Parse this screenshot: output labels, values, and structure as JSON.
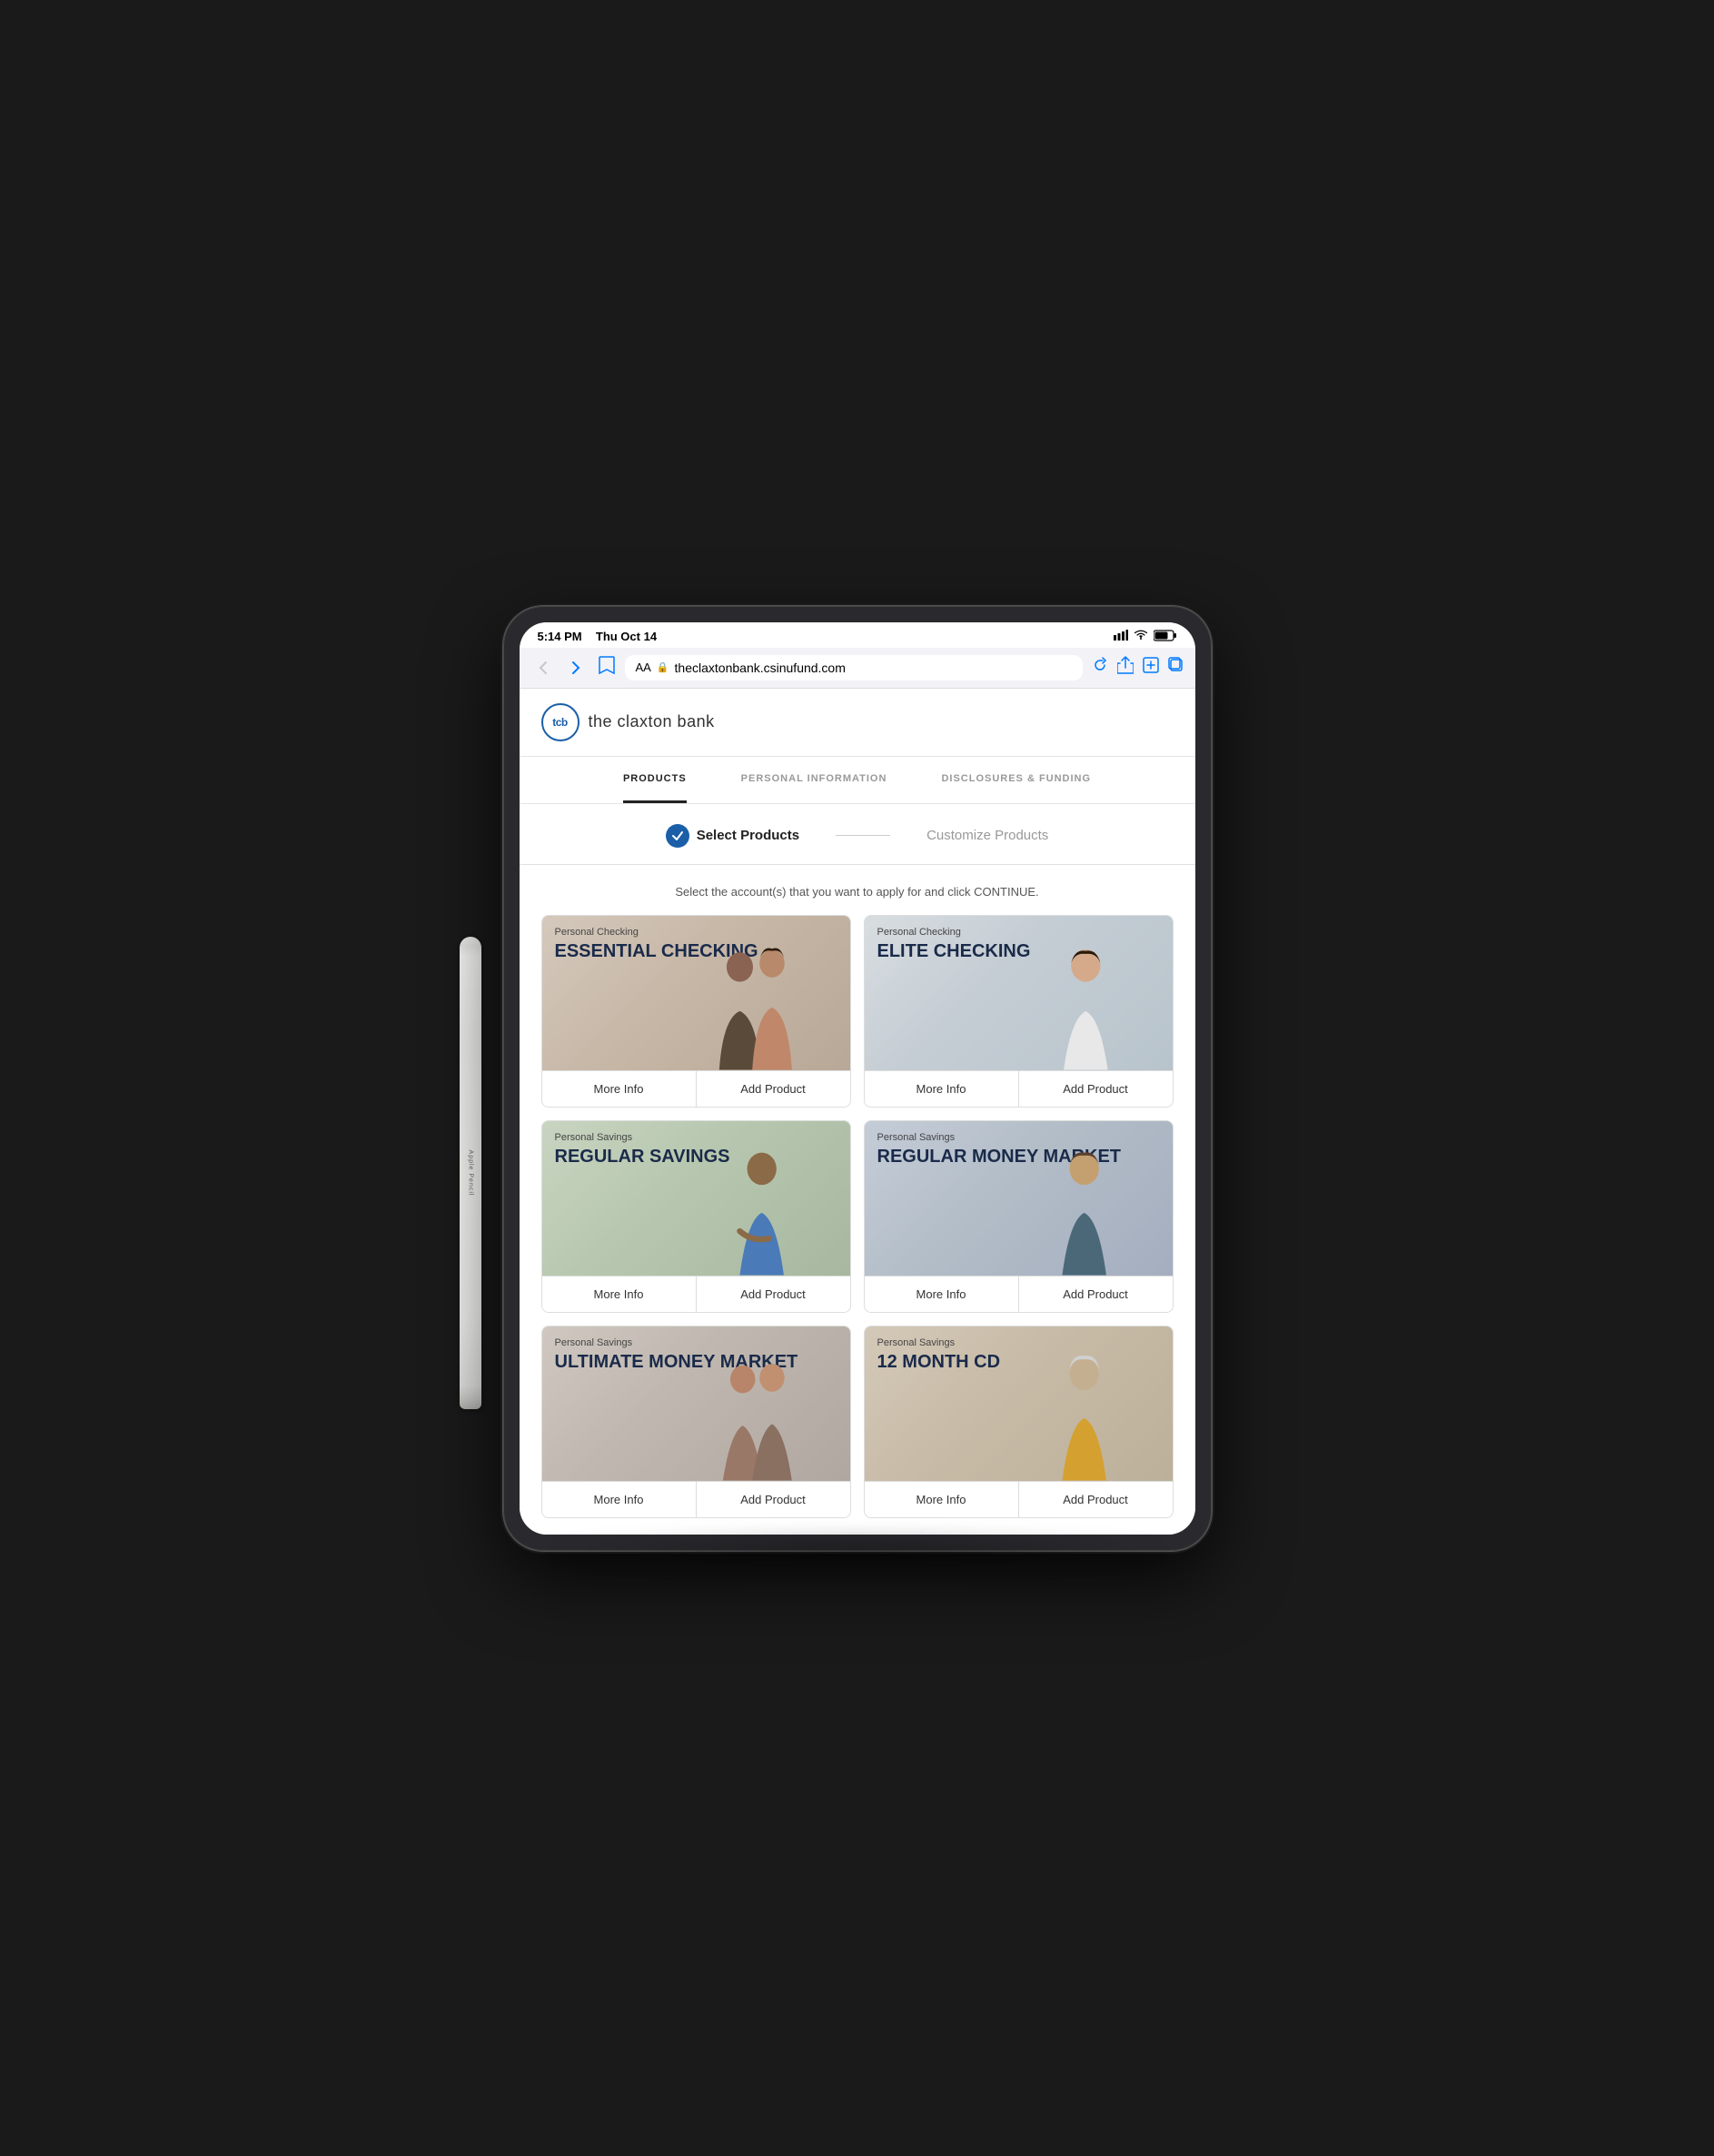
{
  "device": {
    "time": "5:14 PM",
    "date": "Thu Oct 14",
    "signal": "▌▌▌",
    "wifi": "WiFi",
    "battery": "77%"
  },
  "browser": {
    "aa_label": "AA",
    "url": "theclaxtonbank.csinufund.com",
    "lock_icon": "🔒"
  },
  "bank": {
    "badge": "tcb",
    "name": "the claxton bank"
  },
  "nav": {
    "items": [
      {
        "label": "PRODUCTS",
        "active": true
      },
      {
        "label": "PERSONAL INFORMATION",
        "active": false
      },
      {
        "label": "DISCLOSURES & FUNDING",
        "active": false
      }
    ]
  },
  "steps": {
    "step1_label": "Select Products",
    "step2_label": "Customize Products",
    "step1_active": true,
    "step2_active": false
  },
  "instruction": "Select the account(s) that you want to apply for and click CONTINUE.",
  "products": [
    {
      "category": "Personal Checking",
      "title": "ESSENTIAL CHECKING",
      "more_info": "More Info",
      "add_product": "Add Product",
      "theme": "essential"
    },
    {
      "category": "Personal Checking",
      "title": "ELITE CHECKING",
      "more_info": "More Info",
      "add_product": "Add Product",
      "theme": "elite"
    },
    {
      "category": "Personal Savings",
      "title": "REGULAR SAVINGS",
      "more_info": "More Info",
      "add_product": "Add Product",
      "theme": "regular-savings"
    },
    {
      "category": "Personal Savings",
      "title": "REGULAR MONEY MARKET",
      "more_info": "More Info",
      "add_product": "Add Product",
      "theme": "money-market"
    },
    {
      "category": "Personal Savings",
      "title": "ULTIMATE MONEY MARKET",
      "more_info": "More Info",
      "add_product": "Add Product",
      "theme": "ultimate"
    },
    {
      "category": "Personal Savings",
      "title": "12 MONTH CD",
      "more_info": "More Info",
      "add_product": "Add Product",
      "theme": "cd"
    }
  ]
}
